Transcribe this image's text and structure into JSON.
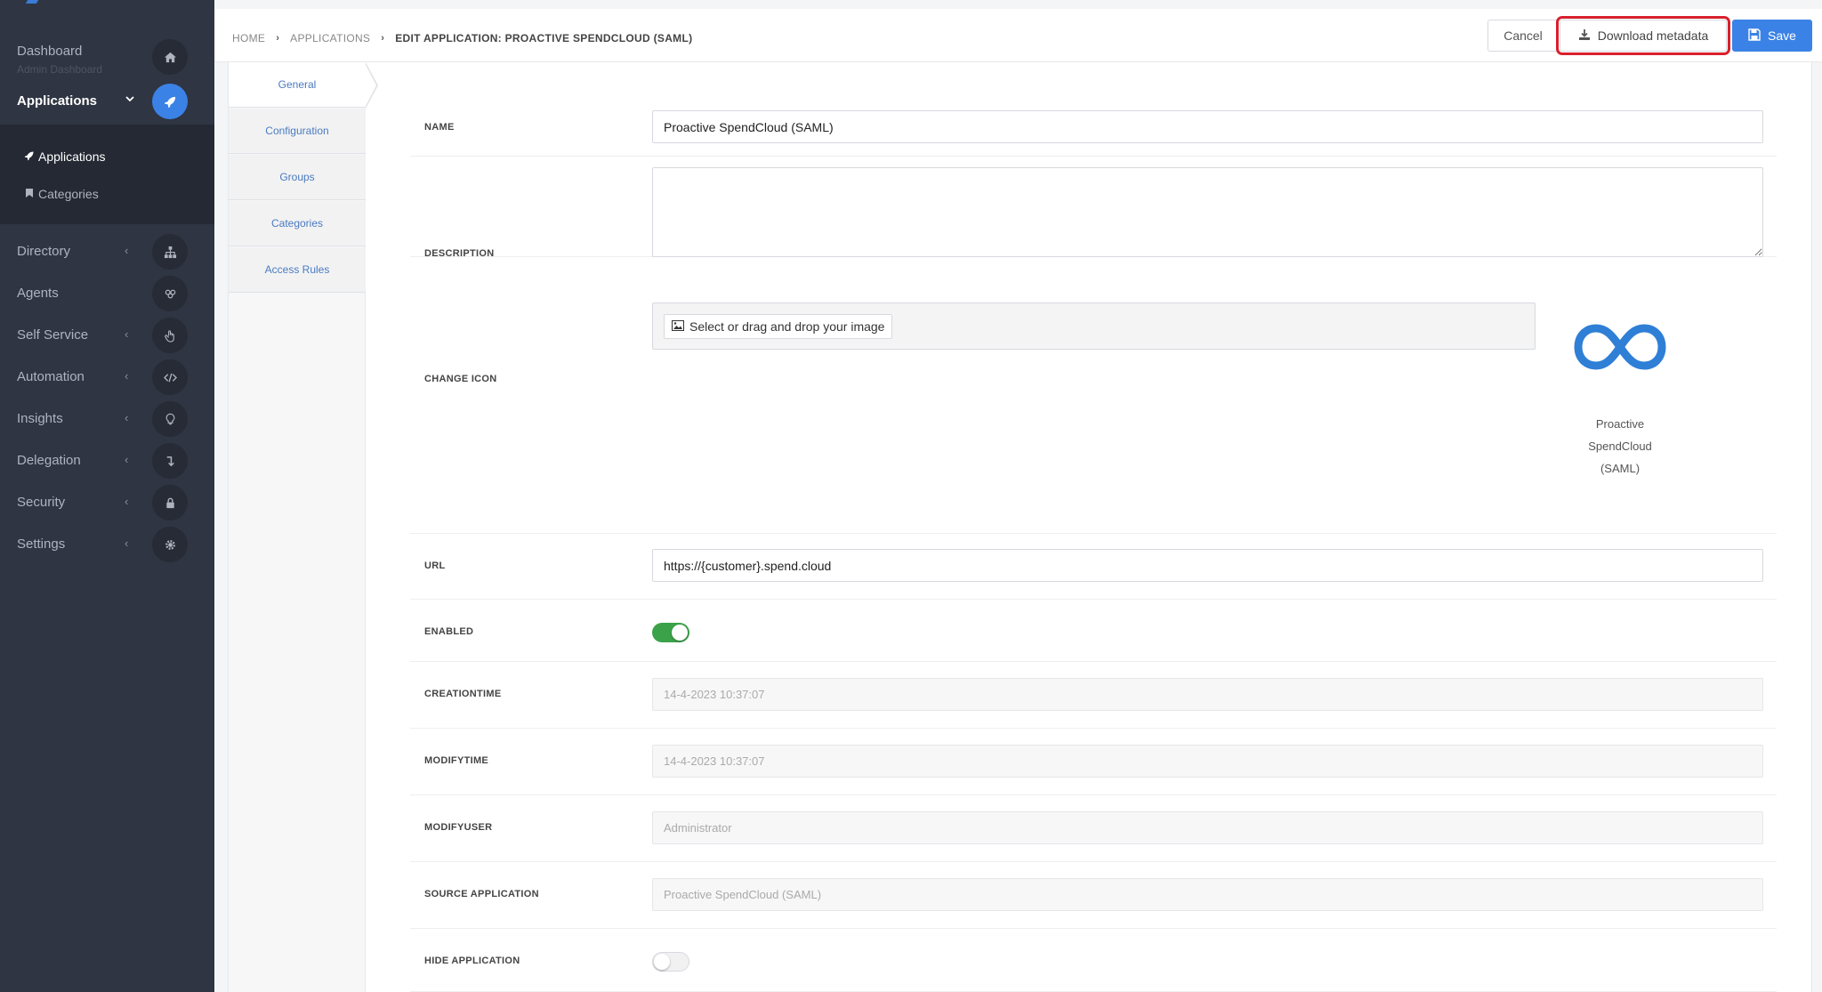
{
  "sidebar": {
    "dashboard": {
      "label": "Dashboard",
      "sub": "Admin Dashboard",
      "icon": "home-icon"
    },
    "applications": {
      "label": "Applications",
      "icon": "rocket-icon"
    },
    "submenu": [
      {
        "label": "Applications",
        "icon": "rocket-icon"
      },
      {
        "label": "Categories",
        "icon": "bookmark-icon"
      }
    ],
    "items": [
      {
        "label": "Directory",
        "icon": "sitemap-icon"
      },
      {
        "label": "Agents",
        "icon": "users-icon"
      },
      {
        "label": "Self Service",
        "icon": "hand-icon"
      },
      {
        "label": "Automation",
        "icon": "code-icon"
      },
      {
        "label": "Insights",
        "icon": "lightbulb-icon"
      },
      {
        "label": "Delegation",
        "icon": "level-down-icon"
      },
      {
        "label": "Security",
        "icon": "lock-icon"
      },
      {
        "label": "Settings",
        "icon": "gear-icon"
      }
    ]
  },
  "breadcrumb": {
    "home": "HOME",
    "applications": "APPLICATIONS",
    "current": "EDIT APPLICATION: PROACTIVE SPENDCLOUD (SAML)"
  },
  "toolbar": {
    "cancel": "Cancel",
    "download": "Download metadata",
    "save": "Save"
  },
  "tabs": [
    "General",
    "Configuration",
    "Groups",
    "Categories",
    "Access Rules"
  ],
  "form": {
    "name": {
      "label": "NAME",
      "value": "Proactive SpendCloud (SAML)"
    },
    "description": {
      "label": "DESCRIPTION",
      "value": ""
    },
    "change_icon": {
      "label": "CHANGE ICON",
      "button": "Select or drag and drop your image",
      "caption_lines": [
        "Proactive",
        "SpendCloud",
        "(SAML)"
      ]
    },
    "url": {
      "label": "URL",
      "value": "https://{customer}.spend.cloud"
    },
    "enabled": {
      "label": "ENABLED",
      "value": true
    },
    "creationtime": {
      "label": "CREATIONTIME",
      "value": "14-4-2023 10:37:07"
    },
    "modifytime": {
      "label": "MODIFYTIME",
      "value": "14-4-2023 10:37:07"
    },
    "modifyuser": {
      "label": "MODIFYUSER",
      "value": "Administrator"
    },
    "source_application": {
      "label": "SOURCE APPLICATION",
      "value": "Proactive SpendCloud (SAML)"
    },
    "hide_application": {
      "label": "HIDE APPLICATION",
      "value": false
    }
  },
  "colors": {
    "sidebar_bg": "#2f3542",
    "accent": "#3b82e6",
    "toggle_on": "#3ba24a",
    "highlight": "#d9202c"
  }
}
